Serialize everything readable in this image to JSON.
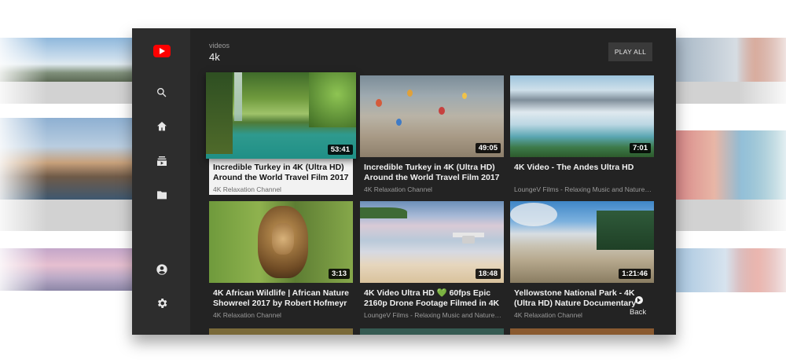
{
  "header": {
    "subtitle": "videos",
    "title": "4k",
    "play_all_label": "PLAY ALL"
  },
  "nav": {
    "items": [
      {
        "name": "search-icon"
      },
      {
        "name": "home-icon"
      },
      {
        "name": "subscriptions-icon"
      },
      {
        "name": "library-icon"
      },
      {
        "name": "account-icon"
      },
      {
        "name": "settings-icon"
      }
    ]
  },
  "videos": [
    {
      "title": "Incredible Turkey in 4K (Ultra HD) Around the World Travel Film 2017 -",
      "channel": "4K Relaxation Channel",
      "duration": "53:41",
      "focused": true
    },
    {
      "title": "Incredible Turkey in 4K (Ultra HD) Around the World Travel Film 2017 -",
      "channel": "4K Relaxation Channel",
      "duration": "49:05"
    },
    {
      "title": "4K Video - The Andes Ultra HD",
      "channel": "LoungeV Films - Relaxing Music and Nature S...",
      "duration": "7:01"
    },
    {
      "title": "4K African Wildlife | African Nature Showreel 2017 by Robert Hofmeyr",
      "channel": "4K Relaxation Channel",
      "duration": "3:13"
    },
    {
      "title": "4K Video Ultra HD 💚 60fps Epic 2160p Drone Footage Filmed in 4K",
      "channel": "LoungeV Films - Relaxing Music and Nature S...",
      "duration": "18:48"
    },
    {
      "title": "Yellowstone National Park - 4K (Ultra HD) Nature Documentary Film -",
      "channel": "4K Relaxation Channel",
      "duration": "1:21:46"
    }
  ],
  "footer": {
    "back_label": "Back"
  },
  "colors": {
    "accent": "#ff0000",
    "surface": "#232323",
    "nav": "#2d2d2d"
  }
}
